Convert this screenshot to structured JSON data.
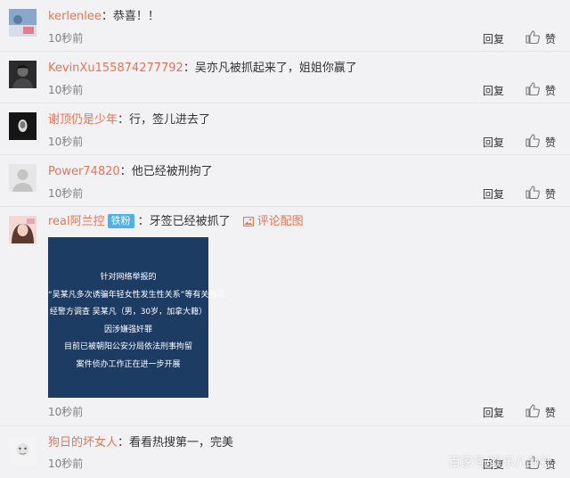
{
  "comments": [
    {
      "user": "kerlenlee",
      "colon": "：",
      "text": "恭喜！！",
      "time": "10秒前",
      "reply": "回复",
      "like": "赞"
    },
    {
      "user": "KevinXu155874277792",
      "colon": "：",
      "text": "吴亦凡被抓起来了，姐姐你赢了",
      "time": "10秒前",
      "reply": "回复",
      "like": "赞"
    },
    {
      "user": "谢顶仍是少年",
      "colon": "：",
      "text": "行，签儿进去了",
      "time": "10秒前",
      "reply": "回复",
      "like": "赞"
    },
    {
      "user": "Power74820",
      "colon": "：",
      "text": "他已经被刑拘了",
      "time": "10秒前",
      "reply": "回复",
      "like": "赞"
    },
    {
      "user": "real阿兰控",
      "badge": "铁粉",
      "colon": "：",
      "text": "牙签已经被抓了",
      "pic_link": "评论配图",
      "time": "10秒前",
      "reply": "回复",
      "like": "赞"
    },
    {
      "user": "狗日的坏女人",
      "colon": "：",
      "text": "看看热搜第一，完美",
      "time": "10秒前",
      "reply": "回复",
      "like": "赞"
    }
  ],
  "poster": {
    "lines": [
      "针对网络举报的",
      "“吴某凡多次诱骗年轻女性发生性关系”等有关情况",
      "经警方调查 吴某凡（男，30岁，加拿大籍）",
      "因涉嫌强奸罪",
      "目前已被朝阳公安分局依法刑事拘留",
      "案件侦办工作正在进一步开展"
    ]
  },
  "watermark": "百家号/娱乐八卦社",
  "icons": {
    "like": "thumbs-up-icon",
    "picture": "image-icon"
  },
  "colors": {
    "username": "#eb7350",
    "badge": "#4eb0e6",
    "poster_bg": "#1d3c63"
  }
}
